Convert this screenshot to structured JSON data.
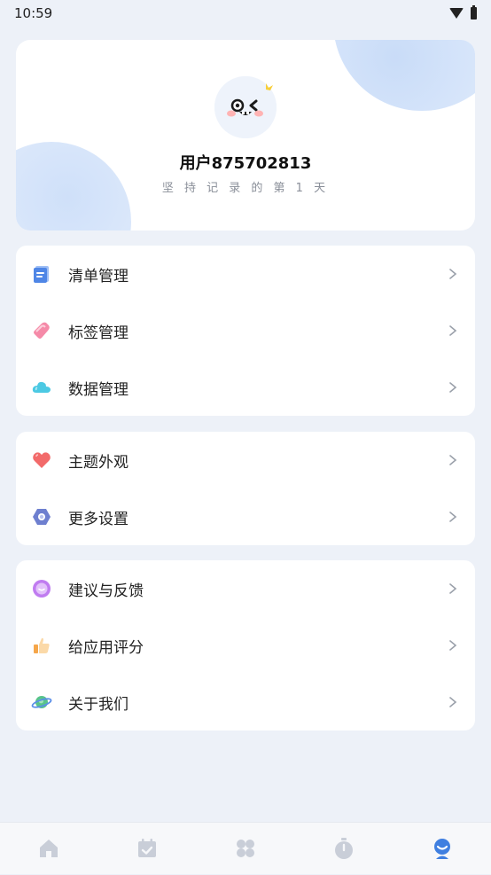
{
  "status_bar": {
    "time": "10:59"
  },
  "profile": {
    "username": "用户875702813",
    "streak_text": "坚 持 记 录 的 第 1 天"
  },
  "groups": [
    {
      "items": [
        {
          "label": "清单管理",
          "icon": "list-doc-icon"
        },
        {
          "label": "标签管理",
          "icon": "tag-icon"
        },
        {
          "label": "数据管理",
          "icon": "cloud-icon"
        }
      ]
    },
    {
      "items": [
        {
          "label": "主题外观",
          "icon": "heart-icon"
        },
        {
          "label": "更多设置",
          "icon": "hex-settings-icon"
        }
      ]
    },
    {
      "items": [
        {
          "label": "建议与反馈",
          "icon": "chat-bubble-icon"
        },
        {
          "label": "给应用评分",
          "icon": "thumbs-up-icon"
        },
        {
          "label": "关于我们",
          "icon": "planet-icon"
        }
      ]
    }
  ],
  "tabbar": {
    "tabs": [
      "home-icon",
      "calendar-check-icon",
      "grid-icon",
      "timer-icon",
      "profile-icon"
    ],
    "active_index": 4
  },
  "colors": {
    "accent": "#3f7fe0",
    "inactive_tab": "#c9ced8",
    "background": "#edf1f8"
  }
}
